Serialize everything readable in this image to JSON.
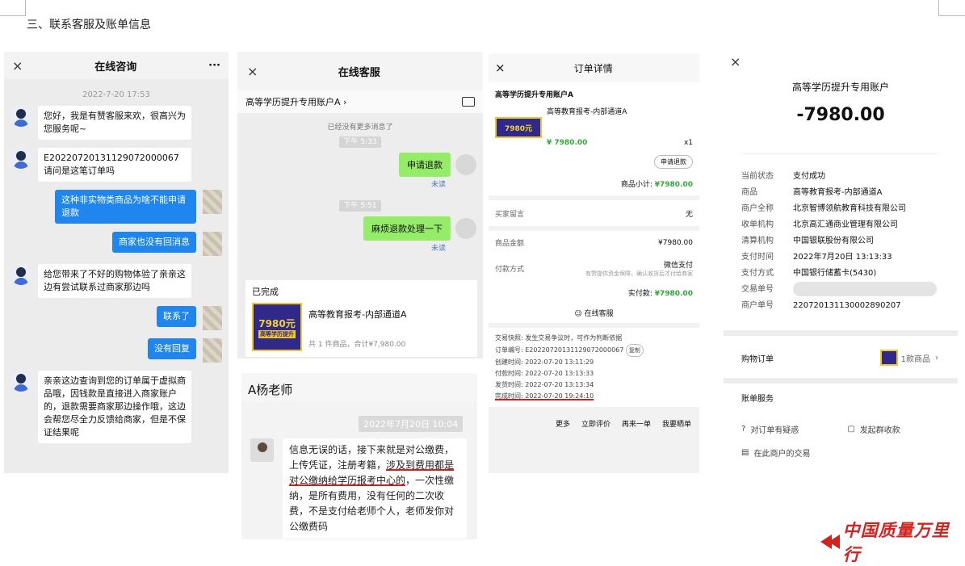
{
  "doc": {
    "heading": "三、联系客服及账单信息"
  },
  "chat1": {
    "title": "在线咨询",
    "close": "×",
    "more": "···",
    "time": "2022-7-20 17:53",
    "m1": "您好，我是有赞客服来欢，很高兴为您服务呢~",
    "m2": "E20220720131129072000067 请问是这笔订单吗",
    "m3": "这种非实物类商品为啥不能申请退款",
    "m4": "商家也没有回消息",
    "m5": "给您带来了不好的购物体验了亲亲这边有尝试联系过商家那边吗",
    "m6": "联系了",
    "m7": "没有回复",
    "m8": "亲亲这边查询到您的订单属于虚拟商品哦，因钱款是直接进入商家账户的，退款需要商家那边操作哦，这边会帮您尽全力反馈给商家，但是不保证结果呢"
  },
  "chat2": {
    "title": "在线客服",
    "close": "×",
    "shop": "高等学历提升专用账户A",
    "shop_arrow": "›",
    "no_more": "已经没有更多消息了",
    "t1": "下午 5:33",
    "b1": "申请退款",
    "r1": "未读",
    "t2": "下午 5:51",
    "b2": "麻烦退款处理一下",
    "r2": "未读",
    "status": "已完成",
    "product": "高等教育报考-内部通道A",
    "summary": "共 1 件商品，合计¥7,980.00",
    "thumb_price": "7980元",
    "thumb_sub": "高等学历提升"
  },
  "chat3": {
    "name": "A杨老师",
    "date": "2022年7月20日 10:04",
    "text_a": "信息无误的话，接下来就是对公缴费，上传凭证，注册考籍，",
    "text_b": "涉及到费用都是对公缴纳给学历报考中心的",
    "text_c": "，一次性缴纳，是所有费用，没有任何的二次收费，不是支付给老师个人，老师发你对公缴费码"
  },
  "order": {
    "title": "订单详情",
    "close": "×",
    "shop": "高等学历提升专用账户A",
    "product": "高等教育报考-内部通道A",
    "price": "¥ 7980.00",
    "qty": "x1",
    "refund_btn": "申请退款",
    "subtotal_label": "商品小计:",
    "subtotal": "¥7980.00",
    "note_label": "买家留言",
    "note": "无",
    "amount_label": "商品金额",
    "amount": "¥7980.00",
    "pay_label": "付款方式",
    "pay_method": "微信支付",
    "pay_note": "有赞提供资金保障，确认收货后才付给商家",
    "paid_label": "实付款:",
    "paid": "¥7980.00",
    "service": "在线客服",
    "rules": "交易快照: 发生交易争议时，可作为判断依据",
    "order_no": "订单编号: E20220720131129072000067",
    "copy": "复制",
    "created": "创建时间: 2022-07-20 13:11:29",
    "paid_time": "付款时间: 2022-07-20 13:13:33",
    "ship_time": "发货时间: 2022-07-20 13:13:34",
    "done_time": "完成时间: 2022-07-20 19:24:10",
    "a1": "更多",
    "a2": "立即评价",
    "a3": "再来一单",
    "a4": "我要晒单"
  },
  "bill": {
    "close": "×",
    "account": "高等学历提升专用账户",
    "amount": "-7980.00",
    "k1": "当前状态",
    "v1": "支付成功",
    "k2": "商品",
    "v2": "高等教育报考-内部通道A",
    "k3": "商户全称",
    "v3": "北京智博领航教育科技有限公司",
    "k4": "收单机构",
    "v4": "北京高汇通商业管理有限公司",
    "k5": "清算机构",
    "v5": "中国银联股份有限公司",
    "k6": "支付时间",
    "v6": "2022年7月20日 13:13:33",
    "k7": "支付方式",
    "v7": "中国银行储蓄卡(5430)",
    "k8": "交易单号",
    "k9": "商户单号",
    "v9": "220720131130002890207",
    "cart_label": "购物订单",
    "cart_value": "1款商品",
    "svc_label": "账单服务",
    "svc1": "对订单有疑惑",
    "svc2": "发起群收款",
    "svc3": "在此商户的交易"
  },
  "logo": {
    "text": "中国质量万里行"
  }
}
